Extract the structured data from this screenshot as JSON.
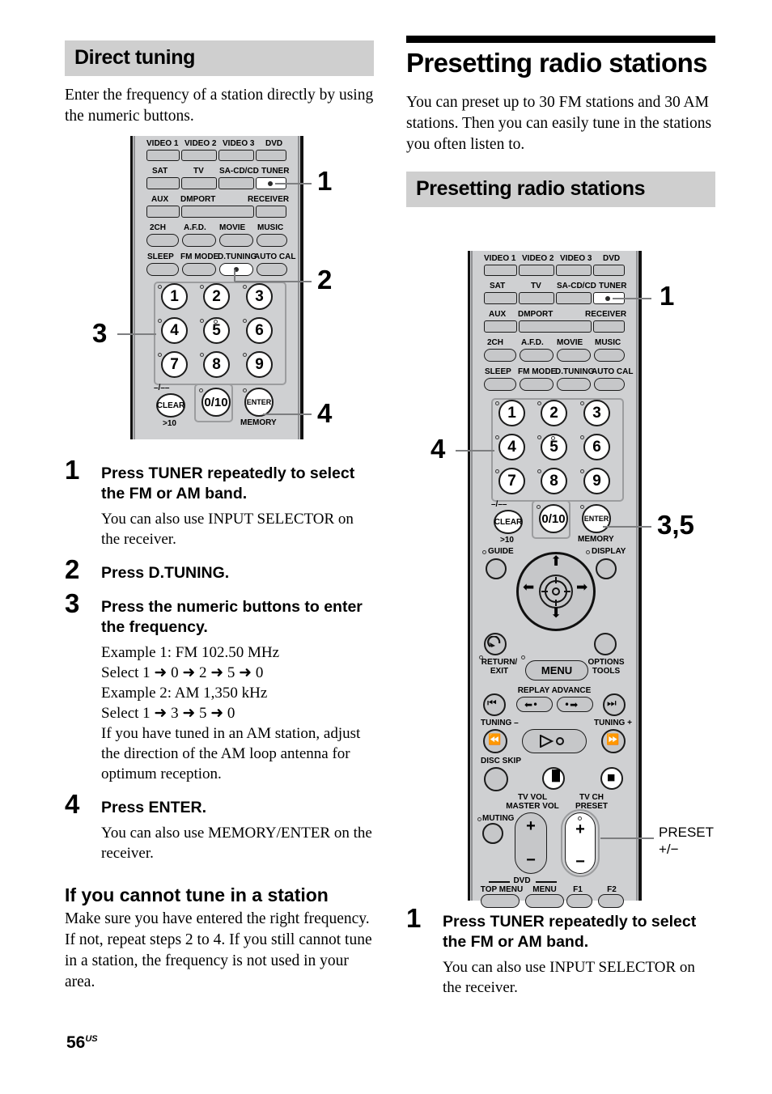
{
  "page": {
    "number": "56",
    "region": "US"
  },
  "left": {
    "section_heading": "Direct tuning",
    "intro": "Enter the frequency of a station directly by using the numeric buttons.",
    "steps": [
      {
        "num": "1",
        "head": "Press TUNER repeatedly to select the FM or AM band.",
        "sub": "You can also use INPUT SELECTOR on the receiver."
      },
      {
        "num": "2",
        "head": "Press D.TUNING.",
        "sub": ""
      },
      {
        "num": "3",
        "head": "Press the numeric buttons to enter the frequency.",
        "sub": "Example 1: FM 102.50 MHz\nSelect 1 ➜ 0 ➜ 2 ➜ 5 ➜ 0\nExample 2: AM 1,350 kHz\nSelect 1 ➜ 3 ➜ 5 ➜ 0\nIf you have tuned in an AM station, adjust the direction of the AM loop antenna for optimum reception."
      },
      {
        "num": "4",
        "head": "Press ENTER.",
        "sub": "You can also use MEMORY/ENTER on the receiver."
      }
    ],
    "subsection_heading": "If you cannot tune in a station",
    "subsection_body": "Make sure you have entered the right frequency. If not, repeat steps 2 to 4. If you still cannot tune in a station, the frequency is not used in your area.",
    "callouts": [
      {
        "id": "1",
        "label": "1",
        "target": "tuner-button"
      },
      {
        "id": "2",
        "label": "2",
        "target": "d-tuning-button"
      },
      {
        "id": "3",
        "label": "3",
        "target": "numeric-buttons"
      },
      {
        "id": "4",
        "label": "4",
        "target": "enter-button"
      }
    ]
  },
  "right": {
    "chapter_title": "Presetting radio stations",
    "intro": "You can preset up to 30 FM stations and 30 AM stations. Then you can easily tune in the stations you often listen to.",
    "section_heading": "Presetting radio stations",
    "steps": [
      {
        "num": "1",
        "head": "Press TUNER repeatedly to select the FM or AM band.",
        "sub": "You can also use INPUT SELECTOR on the receiver."
      }
    ],
    "callouts": [
      {
        "id": "1",
        "label": "1",
        "target": "tuner-button"
      },
      {
        "id": "4",
        "label": "4",
        "target": "numeric-buttons"
      },
      {
        "id": "35",
        "label": "3,5",
        "target": "enter-button"
      },
      {
        "id": "preset",
        "label": "PRESET\n+/−",
        "target": "tv-ch-preset-button"
      }
    ]
  },
  "remote": {
    "input_rows": [
      {
        "labels": [
          "VIDEO 1",
          "VIDEO 2",
          "VIDEO 3",
          "DVD"
        ]
      },
      {
        "labels": [
          "SAT",
          "TV",
          "SA-CD/CD",
          "TUNER"
        ]
      },
      {
        "labels": [
          "AUX",
          "DMPORT",
          "RECEIVER"
        ]
      }
    ],
    "sound_field_row": [
      "2CH",
      "A.F.D.",
      "MOVIE",
      "MUSIC"
    ],
    "function_row": [
      "SLEEP",
      "FM MODE",
      "D.TUNING",
      "AUTO CAL"
    ],
    "numeric": [
      "1",
      "2",
      "3",
      "4",
      "5",
      "6",
      "7",
      "8",
      "9"
    ],
    "bottom_numeric": {
      "clear": "CLEAR",
      "clear_top": "–/––",
      "clear_bottom": ">10",
      "zero": "0/10",
      "enter": "ENTER",
      "enter_bottom": "MEMORY"
    },
    "guide": "GUIDE",
    "display": "DISPLAY",
    "return_exit": "RETURN/\nEXIT",
    "menu": "MENU",
    "options_tools": "OPTIONS\nTOOLS",
    "replay_advance": "REPLAY ADVANCE",
    "tuning_minus": "TUNING –",
    "tuning_plus": "TUNING +",
    "disc_skip": "DISC SKIP",
    "muting": "MUTING",
    "tv_vol": "TV VOL",
    "master_vol": "MASTER VOL",
    "tv_ch": "TV CH",
    "preset": "PRESET",
    "dvd": "DVD",
    "top_menu": "TOP MENU",
    "dvd_menu": "MENU",
    "f1": "F1",
    "f2": "F2",
    "plus": "+",
    "minus": "−"
  },
  "colors": {
    "heading_band": "#cfcfcf",
    "remote_body": "#cfd0d2",
    "button_face": "#c6c7c9",
    "outline": "#1b1b1b",
    "leader": "#7d7e80",
    "text": "#000000"
  }
}
